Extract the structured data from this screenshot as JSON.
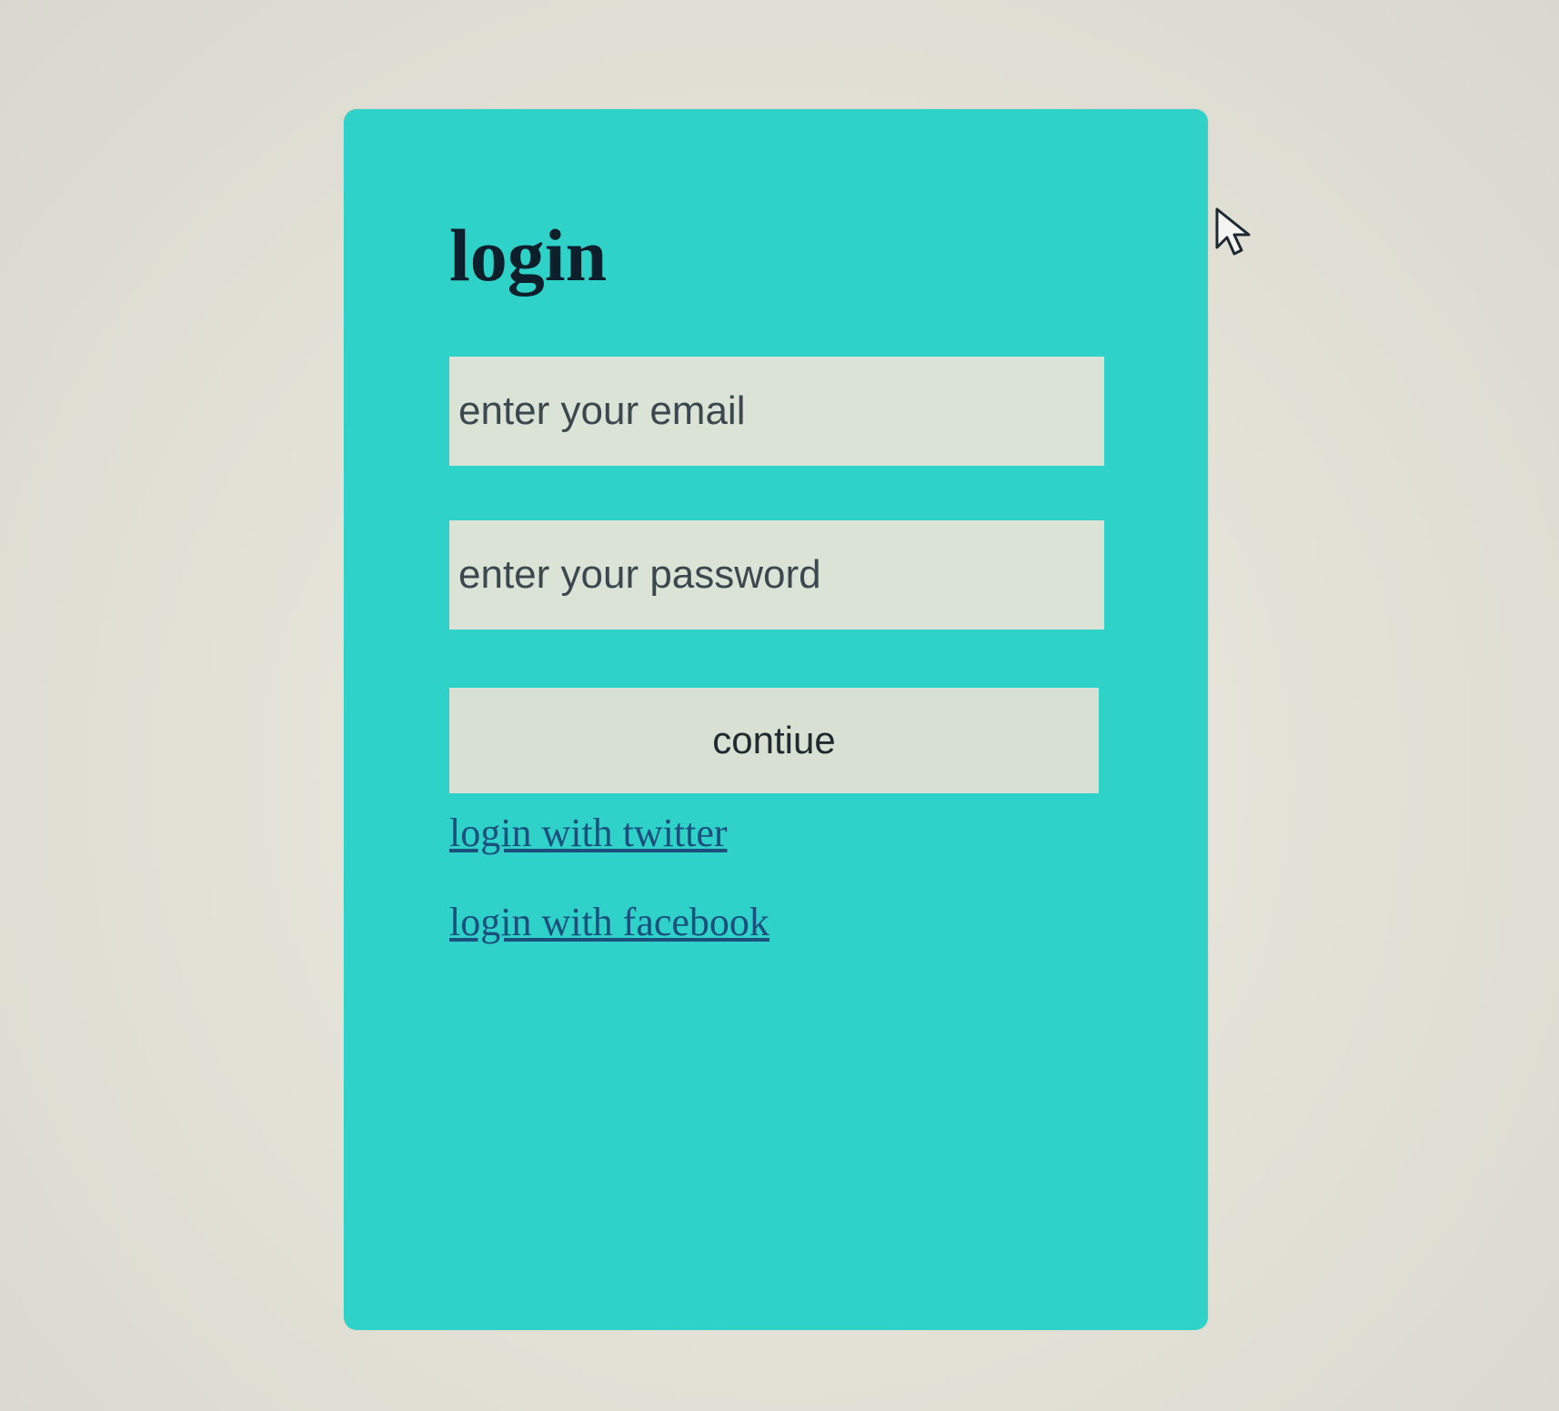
{
  "login_card": {
    "title": "login",
    "email": {
      "placeholder": "enter your email",
      "value": ""
    },
    "password": {
      "placeholder": "enter your password",
      "value": ""
    },
    "continue_label": "contiue",
    "twitter_link": "login with twitter",
    "facebook_link": "login with facebook"
  },
  "colors": {
    "card_background": "#2ed2c9",
    "field_background": "#dbe3d6",
    "link": "#1a4f7e",
    "title": "#0c1f2a"
  },
  "icons": {
    "cursor": "mouse-pointer-icon"
  }
}
